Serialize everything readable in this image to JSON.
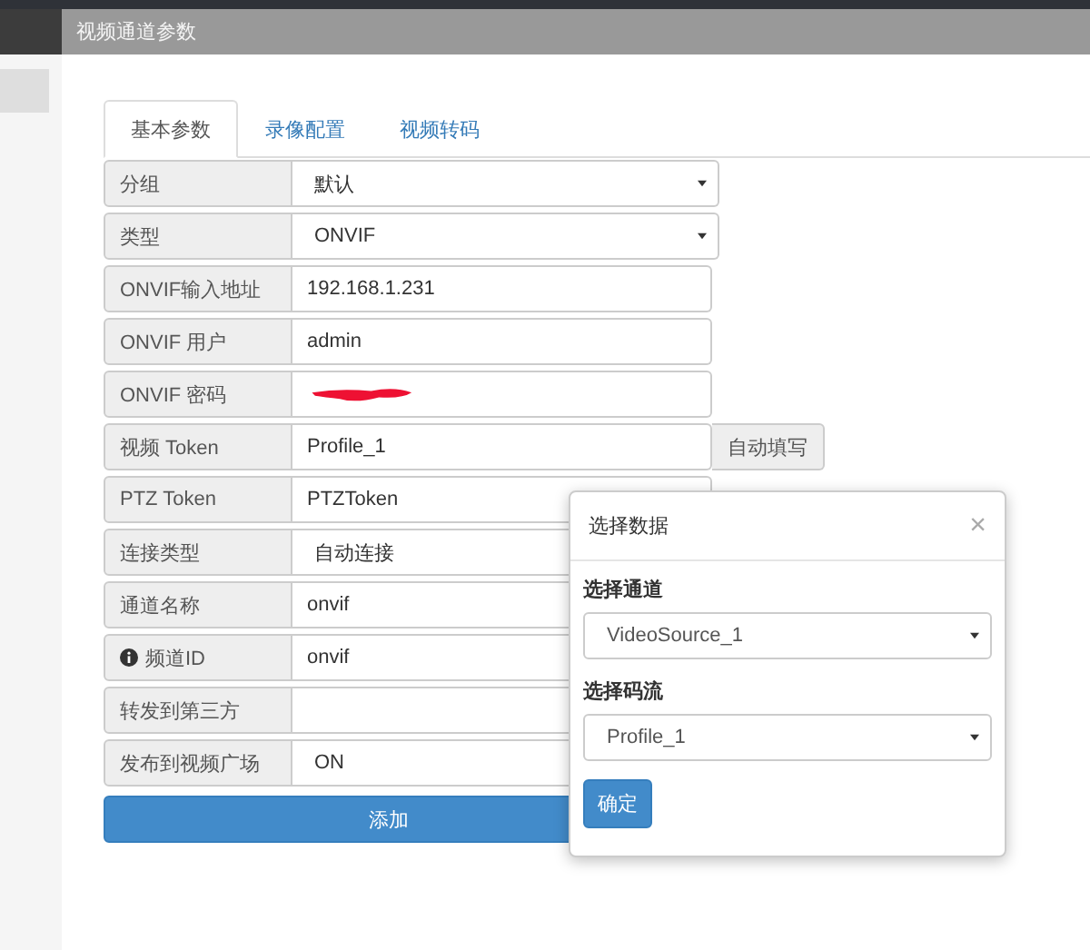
{
  "header": {
    "title": "视频通道参数"
  },
  "tabs": [
    {
      "label": "基本参数",
      "selected": true
    },
    {
      "label": "录像配置",
      "selected": false
    },
    {
      "label": "视频转码",
      "selected": false
    }
  ],
  "rows": [
    {
      "kind": "select",
      "label": "分组",
      "value": "默认"
    },
    {
      "kind": "select",
      "label": "类型",
      "value": "ONVIF"
    },
    {
      "kind": "text",
      "label": "ONVIF输入地址",
      "value": "192.168.1.231"
    },
    {
      "kind": "text",
      "label": "ONVIF 用户",
      "value": "admin"
    },
    {
      "kind": "text",
      "label": "ONVIF 密码",
      "redacted": true
    },
    {
      "kind": "button",
      "label": "视频 Token",
      "value": "Profile_1",
      "button": "自动填写"
    },
    {
      "kind": "text",
      "label": "PTZ Token",
      "value": "PTZToken"
    },
    {
      "kind": "select",
      "label": "连接类型",
      "value": "自动连接"
    },
    {
      "kind": "text",
      "label": "通道名称",
      "value": "onvif"
    },
    {
      "kind": "info",
      "label": "频道ID",
      "value": "onvif"
    },
    {
      "kind": "text",
      "label": "转发到第三方"
    },
    {
      "kind": "select",
      "label": "发布到视频广场",
      "value": "ON"
    }
  ],
  "add_button": "添加",
  "dialog": {
    "title": "选择数据",
    "close": "×",
    "fields": [
      {
        "label": "选择通道",
        "value": "VideoSource_1"
      },
      {
        "label": "选择码流",
        "value": "Profile_1"
      }
    ],
    "confirm": "确定"
  }
}
